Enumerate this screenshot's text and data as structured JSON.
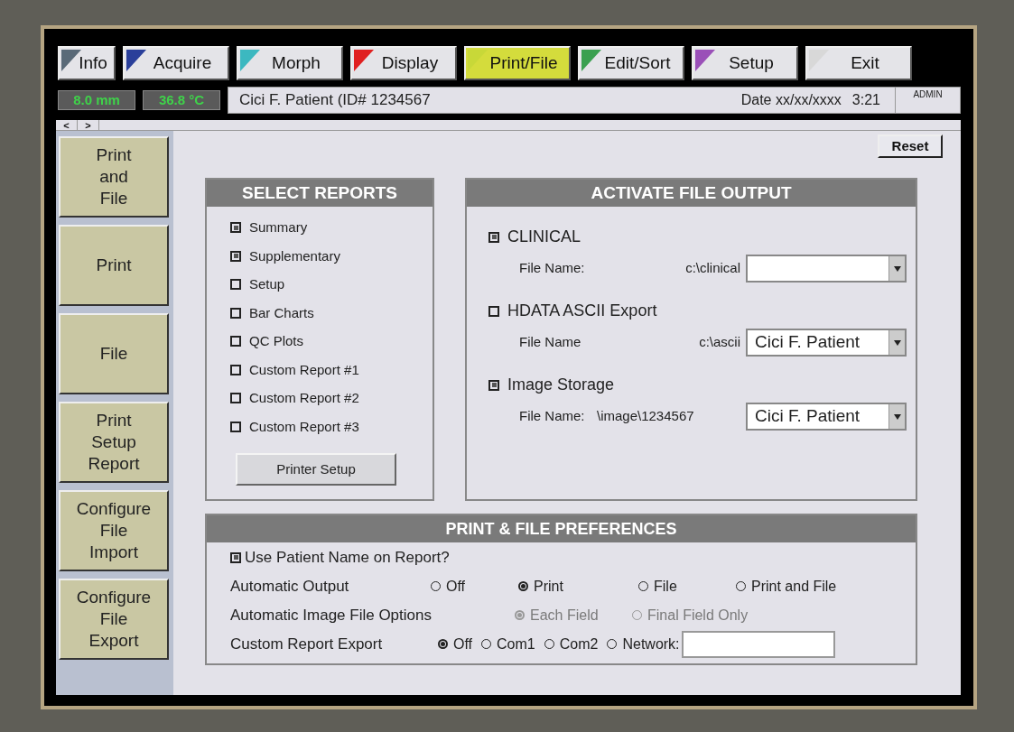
{
  "tabs": [
    {
      "label": "Info",
      "color": "#5a6a78",
      "selected": false
    },
    {
      "label": "Acquire",
      "color": "#2a3f9a",
      "selected": false
    },
    {
      "label": "Morph",
      "color": "#3cb8c0",
      "selected": false
    },
    {
      "label": "Display",
      "color": "#e02020",
      "selected": false
    },
    {
      "label": "Print/File",
      "color": "#c8d838",
      "selected": true
    },
    {
      "label": "Edit/Sort",
      "color": "#3aa050",
      "selected": false
    },
    {
      "label": "Setup",
      "color": "#9a50b8",
      "selected": false
    },
    {
      "label": "Exit",
      "color": "#d8d8d8",
      "selected": false
    }
  ],
  "status": {
    "thickness": "8.0 mm",
    "temperature": "36.8 °C",
    "patient": "Cici F. Patient (ID# 1234567",
    "date": "Date xx/xx/xxxx",
    "time": "3:21",
    "user": "ADMIN"
  },
  "nav": [
    "<",
    ">"
  ],
  "sidebar": [
    {
      "label": "Print\nand\nFile"
    },
    {
      "label": "Print"
    },
    {
      "label": "File"
    },
    {
      "label": "Print\nSetup\nReport"
    },
    {
      "label": "Configure\nFile\nImport"
    },
    {
      "label": "Configure\nFile\nExport"
    }
  ],
  "reset_button": "Reset",
  "select_reports": {
    "title": "SELECT REPORTS",
    "items": [
      {
        "label": "Summary",
        "checked": true
      },
      {
        "label": "Supplementary",
        "checked": true
      },
      {
        "label": "Setup",
        "checked": false
      },
      {
        "label": "Bar Charts",
        "checked": false
      },
      {
        "label": "QC Plots",
        "checked": false
      },
      {
        "label": "Custom Report #1",
        "checked": false
      },
      {
        "label": "Custom Report #2",
        "checked": false
      },
      {
        "label": "Custom Report #3",
        "checked": false
      }
    ],
    "button": "Printer Setup"
  },
  "file_output": {
    "title": "ACTIVATE FILE OUTPUT",
    "items": [
      {
        "label": "CLINICAL",
        "checked": true,
        "field_label": "File Name:",
        "path": "c:\\clinical"
      },
      {
        "label": "HDATA ASCII Export",
        "checked": false,
        "field_label": "File Name",
        "path": "c:\\ascii",
        "value": "Cici F. Patient"
      },
      {
        "label": "Image Storage",
        "checked": true,
        "field_label": "File Name:",
        "path": "\\image\\1234567",
        "value": "Cici F. Patient"
      }
    ]
  },
  "preferences": {
    "title": "PRINT & FILE PREFERENCES",
    "use_name": {
      "label": "Use Patient Name on Report?",
      "checked": true
    },
    "rows": [
      {
        "kind": "spread",
        "label": "Automatic Output",
        "disabled": false,
        "options": [
          {
            "label": "Off",
            "selected": false
          },
          {
            "label": "Print",
            "selected": true
          },
          {
            "label": "File",
            "selected": false
          },
          {
            "label": "Print and File",
            "selected": false
          }
        ]
      },
      {
        "kind": "spread",
        "label": "Automatic Image File Options",
        "disabled": true,
        "options": [
          {
            "label": "Each Field",
            "selected": true
          },
          {
            "label": "Final Field Only",
            "selected": false
          }
        ]
      },
      {
        "kind": "field",
        "label": "Custom Report Export",
        "disabled": false,
        "options": [
          {
            "label": "Off",
            "selected": true
          },
          {
            "label": "Com1",
            "selected": false
          },
          {
            "label": "Com2",
            "selected": false
          },
          {
            "label": "Network:",
            "selected": false
          }
        ]
      }
    ]
  }
}
